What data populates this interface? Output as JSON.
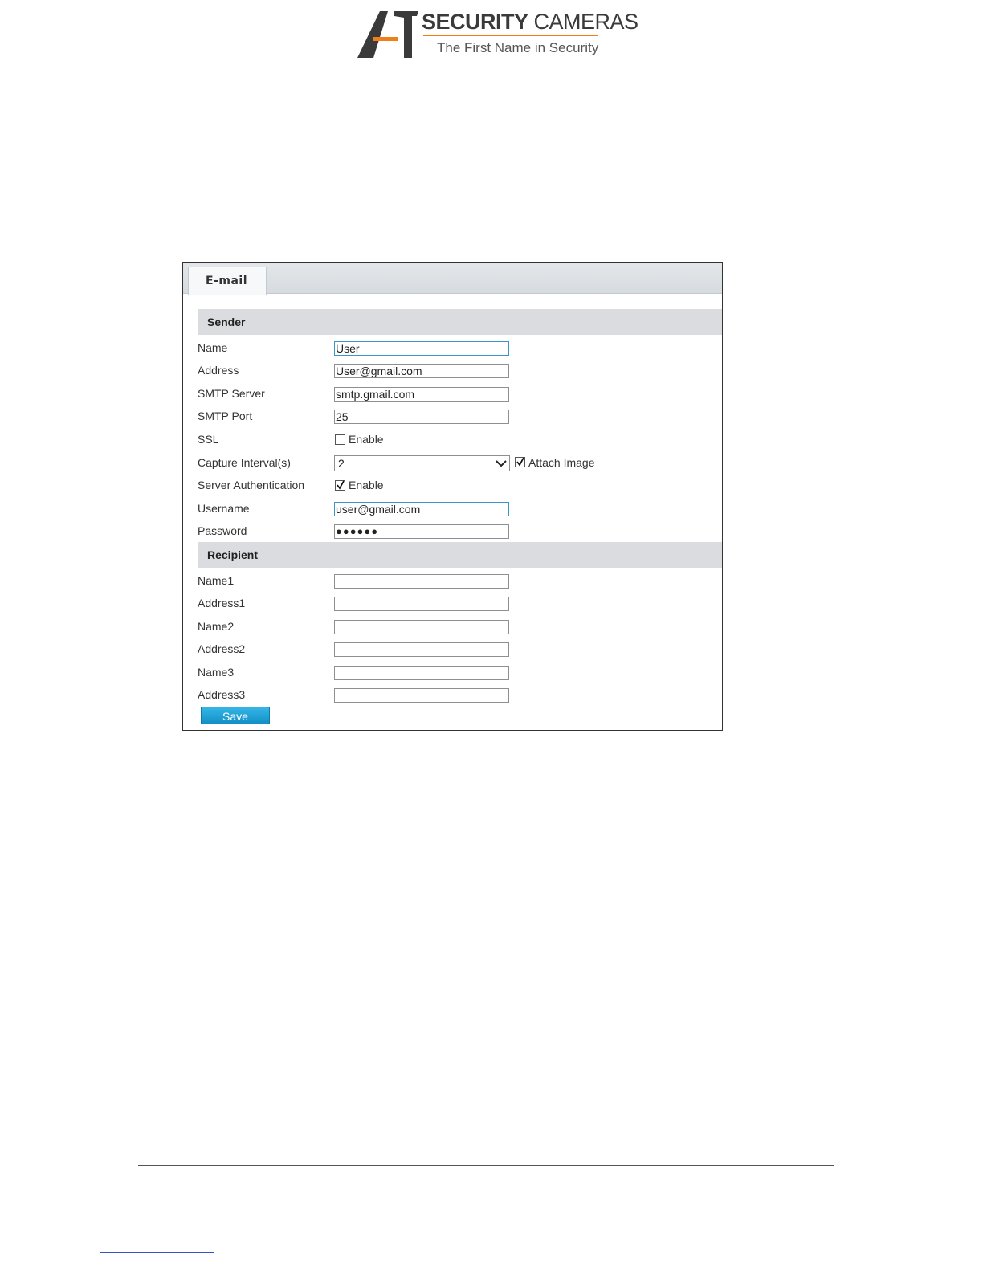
{
  "logo": {
    "title_bold": "SECURITY",
    "title_light": "CAMERAS",
    "tagline": "The First Name in Security",
    "accent_color": "#f07f1a",
    "mark_color": "#3a3a3a"
  },
  "tab": {
    "label": "E-mail"
  },
  "sender": {
    "heading": "Sender",
    "name": {
      "label": "Name",
      "value": "User"
    },
    "address": {
      "label": "Address",
      "value": "User@gmail.com"
    },
    "smtp_server": {
      "label": "SMTP Server",
      "value": "smtp.gmail.com"
    },
    "smtp_port": {
      "label": "SMTP Port",
      "value": "25"
    },
    "ssl": {
      "label": "SSL",
      "checkbox_label": "Enable",
      "checked": false
    },
    "capture_interval": {
      "label": "Capture Interval(s)",
      "value": "2",
      "attach_label": "Attach Image",
      "attach_checked": true
    },
    "server_auth": {
      "label": "Server Authentication",
      "checkbox_label": "Enable",
      "checked": true
    },
    "username": {
      "label": "Username",
      "value": "user@gmail.com"
    },
    "password": {
      "label": "Password",
      "value": "●●●●●●"
    }
  },
  "recipient": {
    "heading": "Recipient",
    "fields": [
      {
        "label": "Name1",
        "value": ""
      },
      {
        "label": "Address1",
        "value": ""
      },
      {
        "label": "Name2",
        "value": ""
      },
      {
        "label": "Address2",
        "value": ""
      },
      {
        "label": "Name3",
        "value": ""
      },
      {
        "label": "Address3",
        "value": ""
      }
    ]
  },
  "save_button": {
    "label": "Save",
    "color": "#1a9fd4"
  }
}
